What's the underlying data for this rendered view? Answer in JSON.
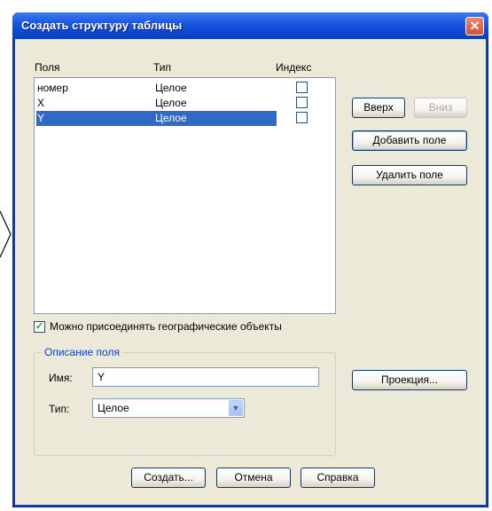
{
  "dialog": {
    "title": "Создать структуру таблицы",
    "close_glyph": "✕"
  },
  "fields_list": {
    "headers": [
      "Поля",
      "Тип",
      "Индекс"
    ],
    "rows": [
      {
        "name": "номер",
        "type": "Целое",
        "index": false,
        "selected": false
      },
      {
        "name": "X",
        "type": "Целое",
        "index": false,
        "selected": false
      },
      {
        "name": "Y",
        "type": "Целое",
        "index": false,
        "selected": true
      }
    ]
  },
  "side_buttons": {
    "up": "Вверх",
    "down": "Вниз",
    "add_field": "Добавить поле",
    "delete_field": "Удалить поле",
    "projection": "Проекция..."
  },
  "geo_checkbox": {
    "label": "Можно присоединять географические объекты",
    "checked": true
  },
  "field_description": {
    "legend": "Описание поля",
    "name_label": "Имя:",
    "name_value": "Y",
    "type_label": "Тип:",
    "type_value": "Целое"
  },
  "bottom_buttons": {
    "create": "Создать...",
    "cancel": "Отмена",
    "help": "Справка"
  },
  "colors": {
    "titlebar": "#0b49d4",
    "selection": "#316ac5",
    "face": "#ece9d8",
    "close": "#d4512f"
  },
  "icons": {
    "close": "close-icon",
    "combo": "chevron-down-icon",
    "check": "check-icon"
  }
}
